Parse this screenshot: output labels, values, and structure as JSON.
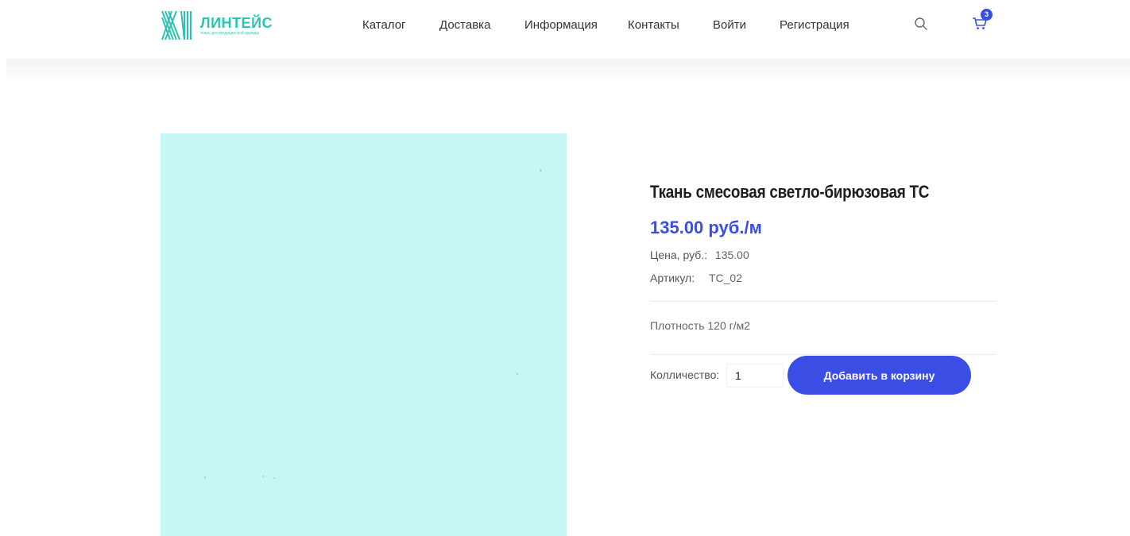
{
  "colors": {
    "accent": "#3a4ee6",
    "brand_teal": "#2dc3b4",
    "product_swatch": "#c7f6f7"
  },
  "brand": {
    "name": "ЛИНТЕЙС",
    "tagline": "ткань для медицинской одежды",
    "logo_icon": "striped-square-logo"
  },
  "nav": {
    "items": [
      {
        "label": "Каталог"
      },
      {
        "label": "Доставка"
      },
      {
        "label": "Информация"
      },
      {
        "label": "Контакты"
      },
      {
        "label": "Войти"
      },
      {
        "label": "Регистрация"
      }
    ]
  },
  "header_icons": {
    "search_icon": "search-icon",
    "cart_icon": "cart-icon",
    "cart_count": "3"
  },
  "product": {
    "title": "Ткань смесовая светло-бирюзовая ТС",
    "price_display": "135.00 руб./м",
    "price_label": "Цена, руб.:",
    "price_value": "135.00",
    "sku_label": "Артикул:",
    "sku_value": "TC_02",
    "density": "Плотность 120 г/м2",
    "quantity_label": "Колличество:",
    "quantity_value": "1",
    "add_to_cart_label": "Добавить в корзину"
  }
}
